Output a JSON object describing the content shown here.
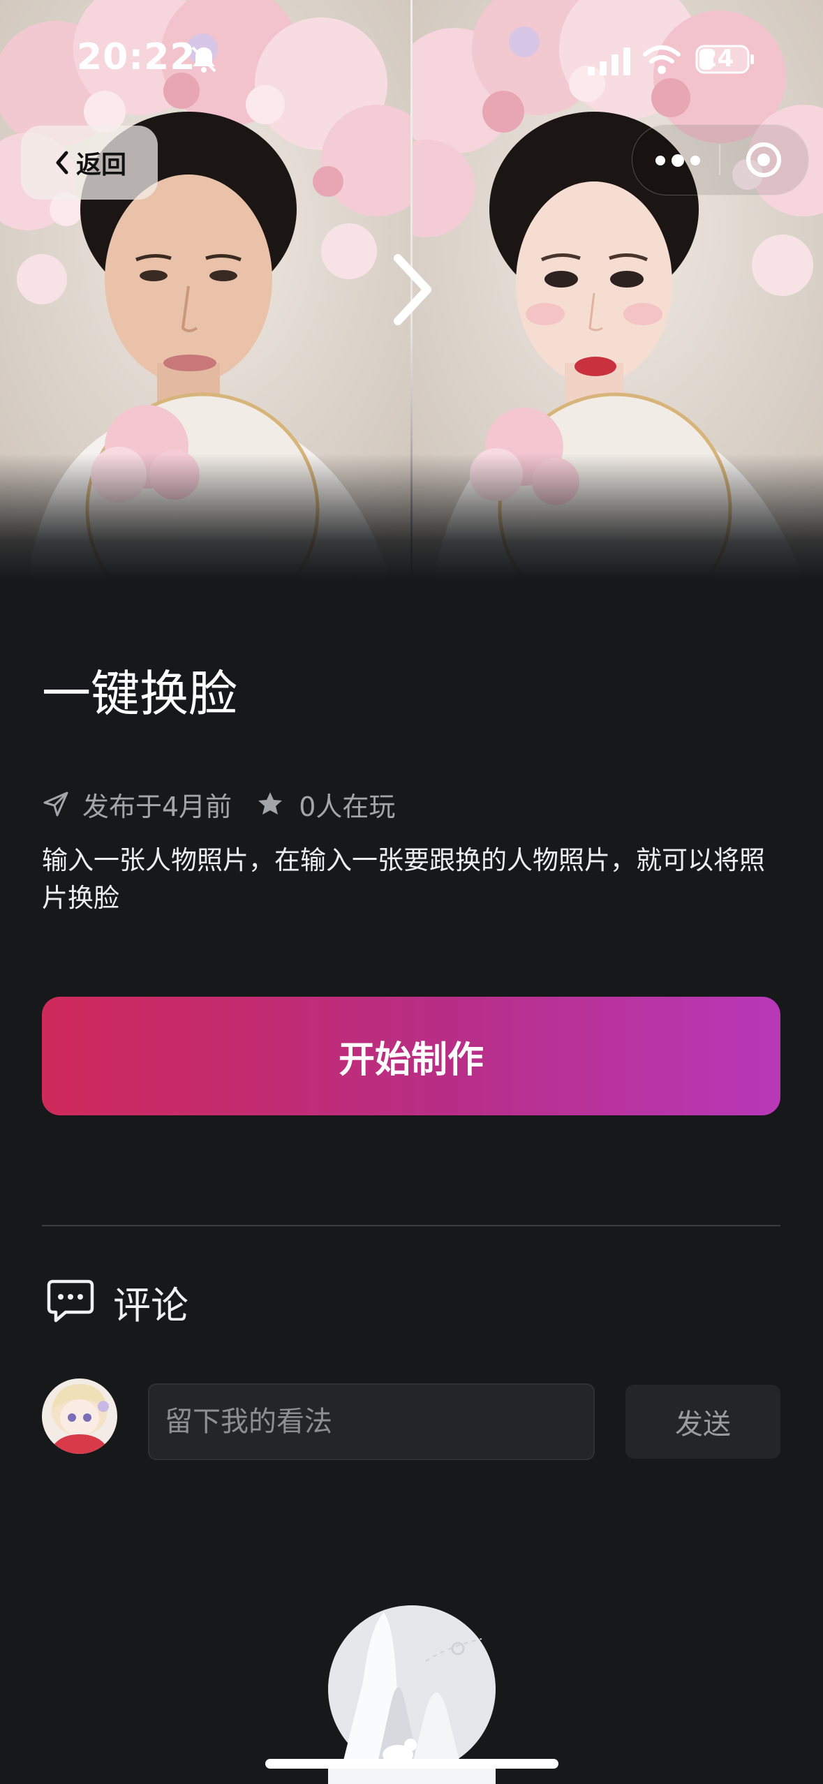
{
  "status_bar": {
    "time": "20:22",
    "battery": "24"
  },
  "nav": {
    "back_label": "返回"
  },
  "template": {
    "title": "一键换脸",
    "published": "发布于4月前",
    "players": "0人在玩",
    "description": "输入一张人物照片，在输入一张要跟换的人物照片，就可以将照片换脸",
    "start_button": "开始制作"
  },
  "comments": {
    "title": "评论",
    "input_placeholder": "留下我的看法",
    "send_label": "发送"
  },
  "colors": {
    "background": "#16181a",
    "button_gradient_start": "#cf2a5b",
    "button_gradient_end": "#b838b8",
    "muted_text": "#a3a6a9"
  }
}
